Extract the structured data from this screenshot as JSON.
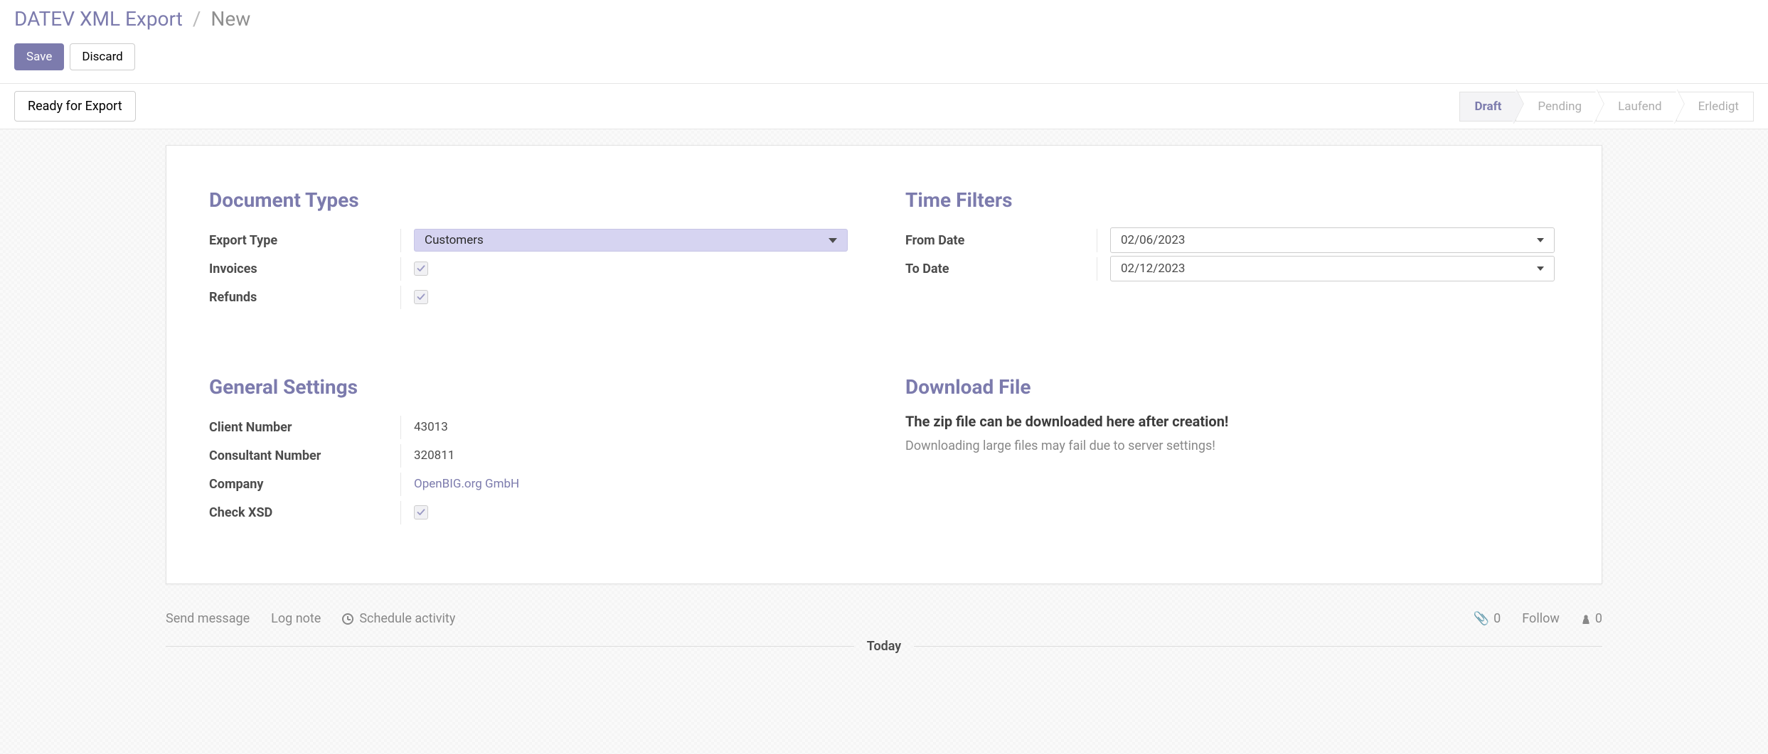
{
  "breadcrumb": {
    "root": "DATEV XML Export",
    "sep": "/",
    "current": "New"
  },
  "buttons": {
    "save": "Save",
    "discard": "Discard",
    "ready": "Ready for Export"
  },
  "status_steps": [
    "Draft",
    "Pending",
    "Laufend",
    "Erledigt"
  ],
  "sections": {
    "document_types": {
      "title": "Document Types",
      "export_type_label": "Export Type",
      "export_type_value": "Customers",
      "invoices_label": "Invoices",
      "invoices_checked": true,
      "refunds_label": "Refunds",
      "refunds_checked": true
    },
    "time_filters": {
      "title": "Time Filters",
      "from_label": "From Date",
      "from_value": "02/06/2023",
      "to_label": "To Date",
      "to_value": "02/12/2023"
    },
    "general_settings": {
      "title": "General Settings",
      "client_number_label": "Client Number",
      "client_number_value": "43013",
      "consultant_number_label": "Consultant Number",
      "consultant_number_value": "320811",
      "company_label": "Company",
      "company_value": "OpenBIG.org GmbH",
      "check_xsd_label": "Check XSD",
      "check_xsd_checked": true
    },
    "download": {
      "title": "Download File",
      "message": "The zip file can be downloaded here after creation!",
      "note": "Downloading large files may fail due to server settings!"
    }
  },
  "chatter": {
    "send_message": "Send message",
    "log_note": "Log note",
    "schedule_activity": "Schedule activity",
    "attachments_count": "0",
    "follow": "Follow",
    "followers_count": "0",
    "today": "Today"
  }
}
